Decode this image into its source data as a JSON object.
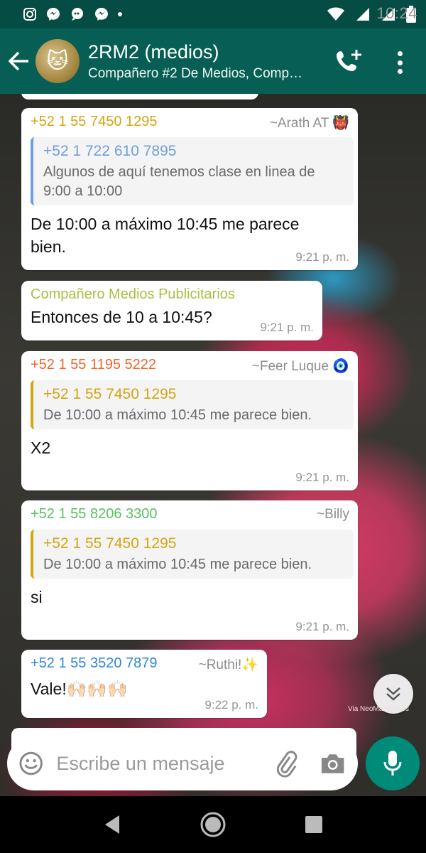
{
  "status_bar": {
    "time": "10:24"
  },
  "header": {
    "title": "2RM2 (medios)",
    "subtitle": "Compañero #2 De Medios, Comp…",
    "avatar_emoji": "🐱"
  },
  "messages": [
    {
      "sender": "+52 1 55 7450 1295",
      "alias": "~Arath AT 👹",
      "color": "#d4a514",
      "quote": {
        "name": "+52 1 722 610 7895",
        "text": "Algunos de aquí tenemos clase en linea de 9:00 a 10:00",
        "color": "#6f9ee0"
      },
      "text": "De 10:00 a máximo 10:45   me parece bien.",
      "time": "9:21 p. m."
    },
    {
      "sender": "Compañero Medios Publicitarios",
      "color": "#a8bf45",
      "text": "Entonces de 10 a 10:45?",
      "time": "9:21 p. m."
    },
    {
      "sender": "+52 1 55 1195 5222",
      "alias": "~Feer Luque 🧿",
      "color": "#f2642a",
      "quote": {
        "name": "+52 1 55 7450 1295",
        "text": "De 10:00 a máximo 10:45   me parece bien.",
        "color": "#d4a514"
      },
      "text": "X2",
      "time": "9:21 p. m."
    },
    {
      "sender": "+52 1 55 8206 3300",
      "alias": "~Billy",
      "color": "#57c15f",
      "quote": {
        "name": "+52 1 55 7450 1295",
        "text": "De 10:00 a máximo 10:45   me parece bien.",
        "color": "#d4a514"
      },
      "text": "si",
      "time": "9:21 p. m."
    },
    {
      "sender": "+52 1 55 3520 7879",
      "alias": "~Ruthi!✨",
      "color": "#2f86d6",
      "text": "Vale!🙌🏻🙌🏻🙌🏻",
      "time": "9:22 p. m."
    }
  ],
  "watermark": "Via NeoMachismos",
  "composer": {
    "placeholder": "Escribe un mensaje"
  },
  "colors": {
    "header": "#075e54",
    "status_bar": "#054d44",
    "accent": "#008a78"
  }
}
